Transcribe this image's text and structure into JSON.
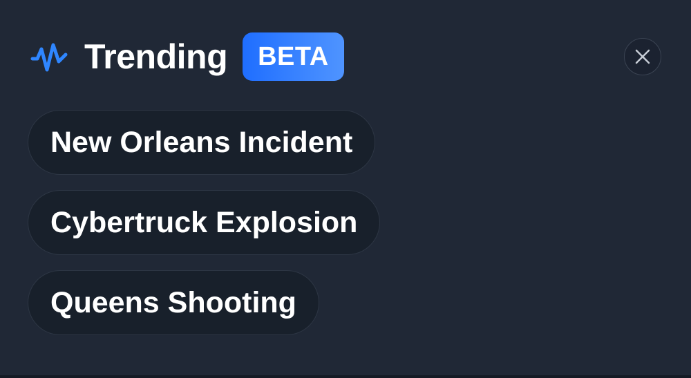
{
  "header": {
    "title": "Trending",
    "badge": "BETA",
    "icon": "pulse-wave-icon",
    "close_icon": "close-icon"
  },
  "trending": {
    "items": [
      {
        "label": "New Orleans Incident"
      },
      {
        "label": "Cybertruck Explosion"
      },
      {
        "label": "Queens Shooting"
      }
    ]
  },
  "colors": {
    "background": "#202836",
    "accent": "#1f6eff",
    "pill_background": "#18202b",
    "text": "#ffffff"
  }
}
